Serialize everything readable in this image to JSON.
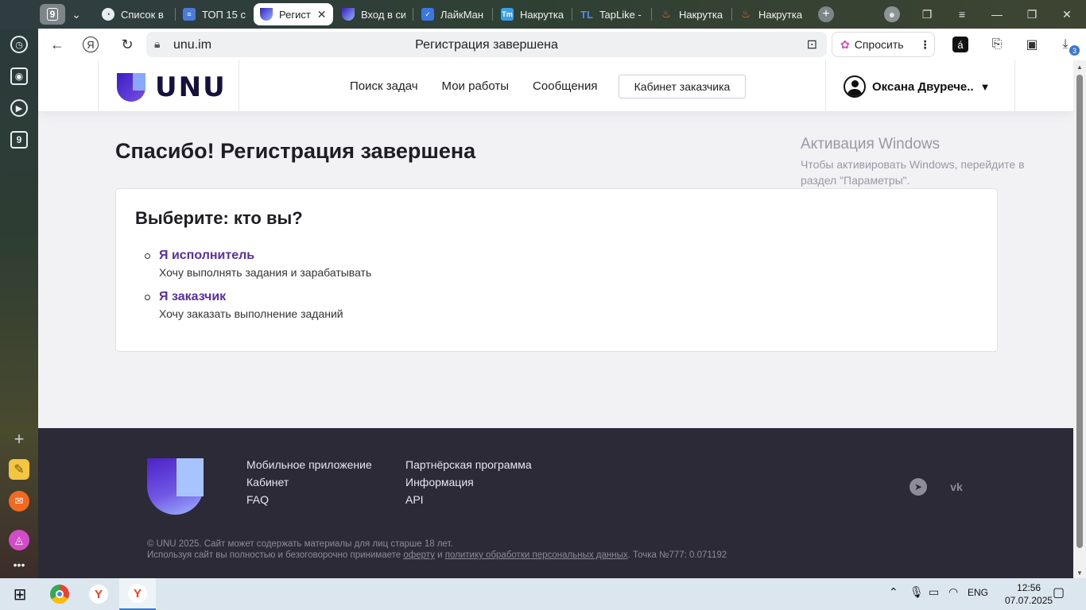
{
  "browser": {
    "tab_counter": "9",
    "tabs": [
      {
        "label": "Список в",
        "icon": "app-logo-icon",
        "color": "#1f2a33"
      },
      {
        "label": "ТОП 15 с",
        "icon": "doc-icon",
        "color": "#4a7bd8"
      },
      {
        "label": "Регист",
        "icon": "unu-icon",
        "color": "#5a35c8"
      },
      {
        "label": "Вход в си",
        "icon": "unu-icon",
        "color": "#5a35c8"
      },
      {
        "label": "ЛайкМан",
        "icon": "check-icon",
        "color": "#3a78e0"
      },
      {
        "label": "Накрутка",
        "icon": "tm-icon",
        "color": "#3aa0e6"
      },
      {
        "label": "TapLike -",
        "icon": "tl-icon",
        "color": "#1a73e8"
      },
      {
        "label": "Накрутка",
        "icon": "fire-icon",
        "color": "#e0492a"
      },
      {
        "label": "Накрутка",
        "icon": "fire-icon",
        "color": "#e0492a"
      }
    ],
    "url": "unu.im",
    "page_title": "Регистрация завершена",
    "ask_button": "Спросить",
    "downloads_badge": "3"
  },
  "site": {
    "brand": "UNU",
    "nav": [
      "Поиск задач",
      "Мои работы",
      "Сообщения"
    ],
    "cabinet_button": "Кабинет заказчика",
    "user_name": "Оксана Двурече..",
    "heading": "Спасибо! Регистрация завершена",
    "card_title": "Выберите: кто вы?",
    "roles": [
      {
        "label": "Я исполнитель",
        "desc": "Хочу выполнять задания и зарабатывать"
      },
      {
        "label": "Я заказчик",
        "desc": "Хочу заказать выполнение заданий"
      }
    ],
    "footer": {
      "col1": [
        "Мобильное приложение",
        "Кабинет",
        "FAQ"
      ],
      "col2": [
        "Партнёрская программа",
        "Информация",
        "API"
      ],
      "copyright": "© UNU 2025. Сайт может содержать материалы для лиц старше 18 лет.",
      "agree_prefix": "Используя сайт вы полностью и безоговорочно принимаете",
      "offer_link": "оферту",
      "and_text": "и",
      "policy_link": "политику обработки персональных данных",
      "point_text": ". Точка №777: 0.071192"
    },
    "accent_color": "#5a2ea6"
  },
  "windows": {
    "activate_title": "Активация Windows",
    "activate_desc": "Чтобы активировать Windows, перейдите в раздел \"Параметры\".",
    "lang": "ENG",
    "time": "12:56",
    "date": "07.07.2025"
  }
}
